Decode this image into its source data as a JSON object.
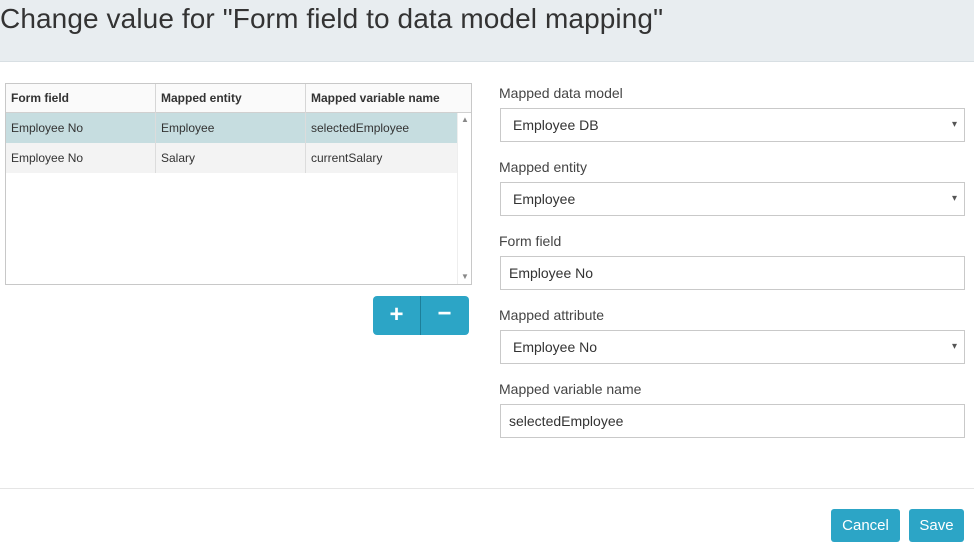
{
  "dialog": {
    "title": "Change value for \"Form field to data model mapping\""
  },
  "grid": {
    "columns": [
      "Form field",
      "Mapped entity",
      "Mapped variable name"
    ],
    "rows": [
      [
        "Employee No",
        "Employee",
        "selectedEmployee"
      ],
      [
        "Employee No",
        "Salary",
        "currentSalary"
      ]
    ],
    "selected_row": 0
  },
  "grid_buttons": {
    "add": "+",
    "remove": "−"
  },
  "form": {
    "mapped_data_model": {
      "label": "Mapped data model",
      "value": "Employee DB"
    },
    "mapped_entity": {
      "label": "Mapped entity",
      "value": "Employee"
    },
    "form_field": {
      "label": "Form field",
      "value": "Employee No"
    },
    "mapped_attribute": {
      "label": "Mapped attribute",
      "value": "Employee No"
    },
    "mapped_variable_name": {
      "label": "Mapped variable name",
      "value": "selectedEmployee"
    }
  },
  "icons": {
    "dropdown": "▾",
    "scroll_up": "▲",
    "scroll_down": "▼"
  },
  "footer": {
    "cancel_label": "Cancel",
    "save_label": "Save"
  },
  "colors": {
    "accent": "#2ca5c6",
    "header_bg": "#e8edf0",
    "selected_row": "#c6dde0"
  }
}
